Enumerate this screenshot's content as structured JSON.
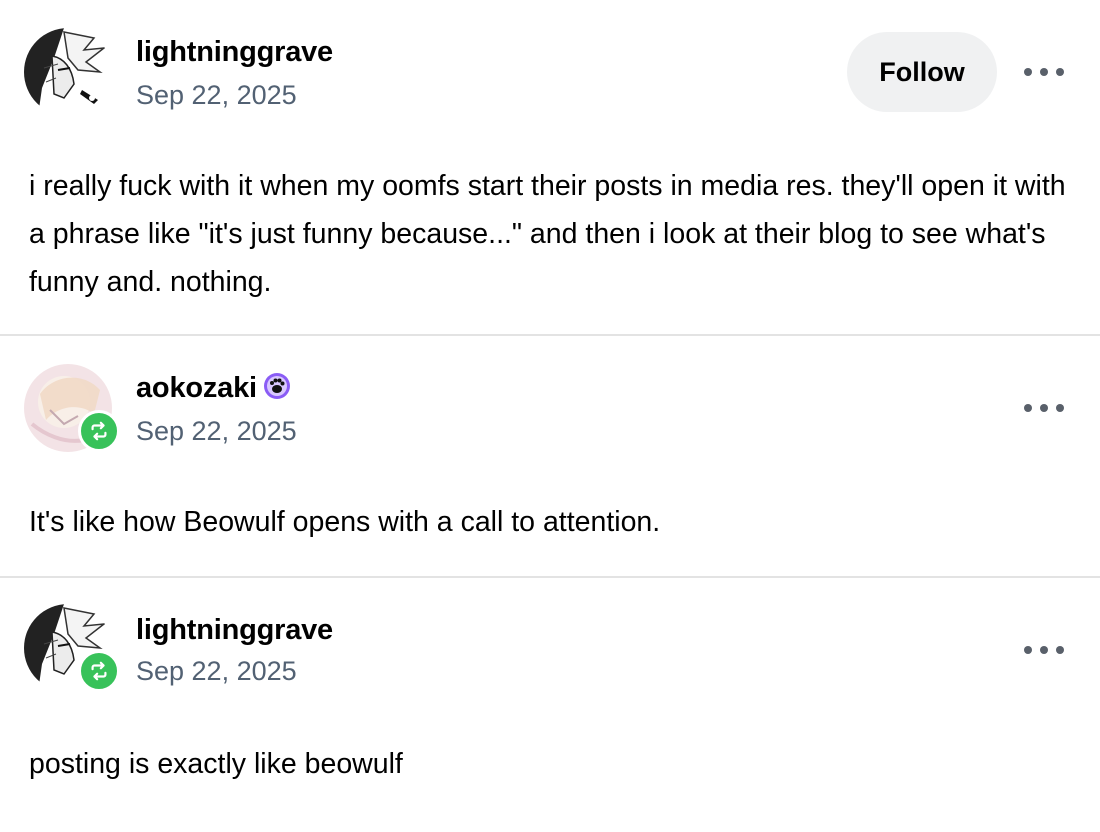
{
  "posts": [
    {
      "username": "lightninggrave",
      "date": "Sep 22, 2025",
      "follow_label": "Follow",
      "body": "i really fuck with it when my oomfs start their posts in media res. they'll open it with a phrase like \"it's just funny because...\" and then i look at their blog to see what's funny and. nothing.",
      "avatar_icon": "manga-avatar-icon"
    },
    {
      "username": "aokozaki",
      "date": "Sep 22, 2025",
      "body": "It's like how Beowulf opens with a call to attention.",
      "badge_icon": "paw-badge-icon",
      "reblog_icon": "reblog-icon"
    },
    {
      "username": "lightninggrave",
      "date": "Sep 22, 2025",
      "body": "posting is exactly like beowulf",
      "reblog_icon": "reblog-icon"
    }
  ],
  "colors": {
    "date_gray": "#526173",
    "reblog_green": "#38c25a",
    "follow_bg": "#f0f1f2",
    "badge_purple": "#8a5cf5"
  }
}
